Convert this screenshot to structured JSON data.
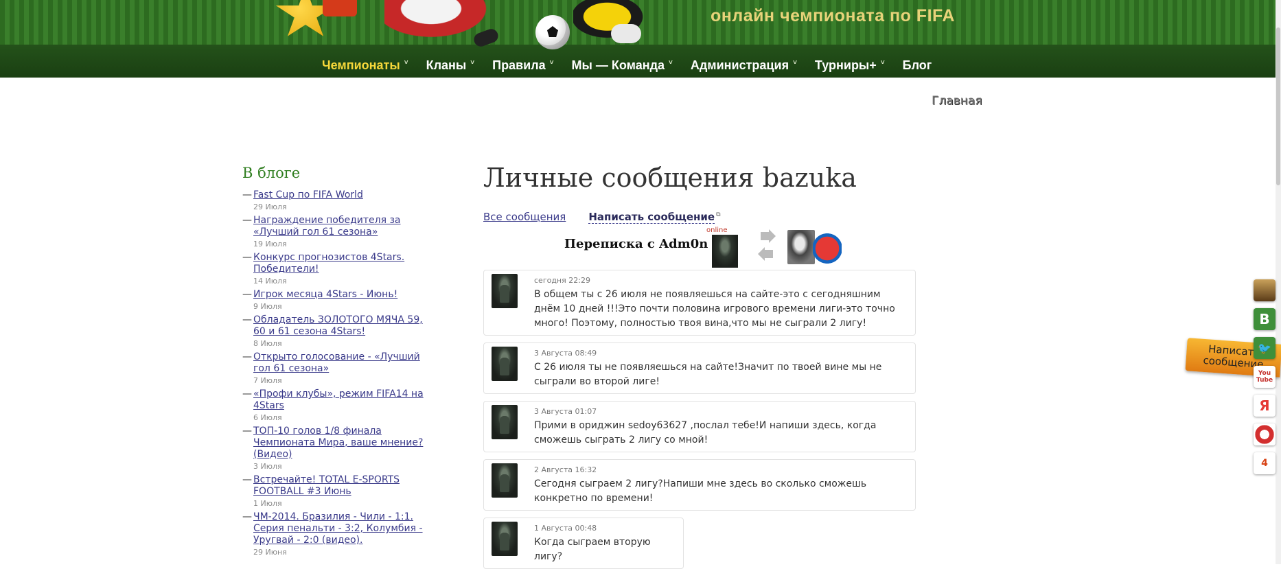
{
  "header": {
    "tagline": "онлайн чемпионата по FIFA"
  },
  "nav": {
    "items": [
      {
        "label": "Чемпионаты",
        "active": true,
        "has_menu": true
      },
      {
        "label": "Кланы",
        "has_menu": true
      },
      {
        "label": "Правила",
        "has_menu": true
      },
      {
        "label": "Мы — Команда",
        "has_menu": true
      },
      {
        "label": "Администрация",
        "has_menu": true
      },
      {
        "label": "Турниры+",
        "has_menu": true
      },
      {
        "label": "Блог",
        "has_menu": false
      }
    ],
    "caret": "˅"
  },
  "breadcrumb": "Главная",
  "sidebar": {
    "title": "В блоге",
    "items": [
      {
        "title": "Fast Cup по FIFA World",
        "date": "29 Июля"
      },
      {
        "title": "Награждение победителя за «Лучший гол 61 сезона»",
        "date": "19 Июля"
      },
      {
        "title": "Конкурс прогнозистов 4Stars. Победители!",
        "date": "14 Июля"
      },
      {
        "title": "Игрок месяца 4Stars - Июнь!",
        "date": "9 Июля"
      },
      {
        "title": "Обладатель ЗОЛОТОГО МЯЧА 59, 60 и 61 сезона 4Stars!",
        "date": "8 Июля"
      },
      {
        "title": "Открыто голосование - «Лучший гол 61 сезона»",
        "date": "7 Июля"
      },
      {
        "title": "«Профи клубы», режим FIFA14 на 4Stars",
        "date": "6 Июля"
      },
      {
        "title": "ТОП-10 голов 1/8 финала Чемпионата Мира, ваше мнение? (Видео)",
        "date": "3 Июля"
      },
      {
        "title": "Встречайте! TOTAL E-SPORTS FOOTBALL #3 Июнь",
        "date": "1 Июля"
      },
      {
        "title": "ЧМ-2014. Бразилия - Чили - 1:1. Серия пенальти - 3:2, Колумбия - Уругвай - 2:0 (видео).",
        "date": "29 Июня"
      }
    ]
  },
  "main": {
    "title": "Личные сообщения bazuka",
    "actions": {
      "all_messages": "Все сообщения",
      "write_message": "Написать сообщение"
    },
    "correspondence": {
      "title": "Переписка с Adm0n",
      "online": "online"
    },
    "messages": [
      {
        "time": "сегодня 22:29",
        "text": "В общем ты с 26 июля не появляешься на сайте-это с сегодняшним днём 10 дней !!!Это почти половина игрового времени лиги-это точно много! Поэтому, полностью твоя вина,что мы не сыграли 2 лигу!"
      },
      {
        "time": "3 Августа 08:49",
        "text": "С 26 июля ты не появляешься на сайте!Значит по твоей вине мы не сыграли во второй лиге!"
      },
      {
        "time": "3 Августа 01:07",
        "text": "Прими в ориджин sedoy63627 ,послал тебе!И напиши здесь, когда сможешь сыграть 2 лигу со мной!"
      },
      {
        "time": "2 Августа 16:32",
        "text": "Сегодня сыграем 2 лигу?Напиши мне здесь во сколько сможешь конкретно по времени!"
      },
      {
        "time": "1 Августа 00:48",
        "text": "Когда сыграем вторую лигу?"
      }
    ]
  },
  "widget": {
    "write_tab": "Написать сообщение"
  },
  "social": {
    "icons": [
      {
        "name": "officer-cap-icon",
        "color": "#7a5a2a",
        "glyph": ""
      },
      {
        "name": "vkontakte-icon",
        "color": "#3f8f3a",
        "glyph": "В"
      },
      {
        "name": "twitter-icon",
        "color": "#3f8f3a",
        "glyph": "🐦"
      },
      {
        "name": "youtube-icon",
        "color": "#ffffff",
        "glyph": "You Tube"
      },
      {
        "name": "yandex-icon",
        "color": "#ffffff",
        "glyph": "Я"
      },
      {
        "name": "lifebuoy-icon",
        "color": "#ffffff",
        "glyph": ""
      },
      {
        "name": "star-icon",
        "color": "#ffffff",
        "glyph": "4"
      }
    ]
  }
}
